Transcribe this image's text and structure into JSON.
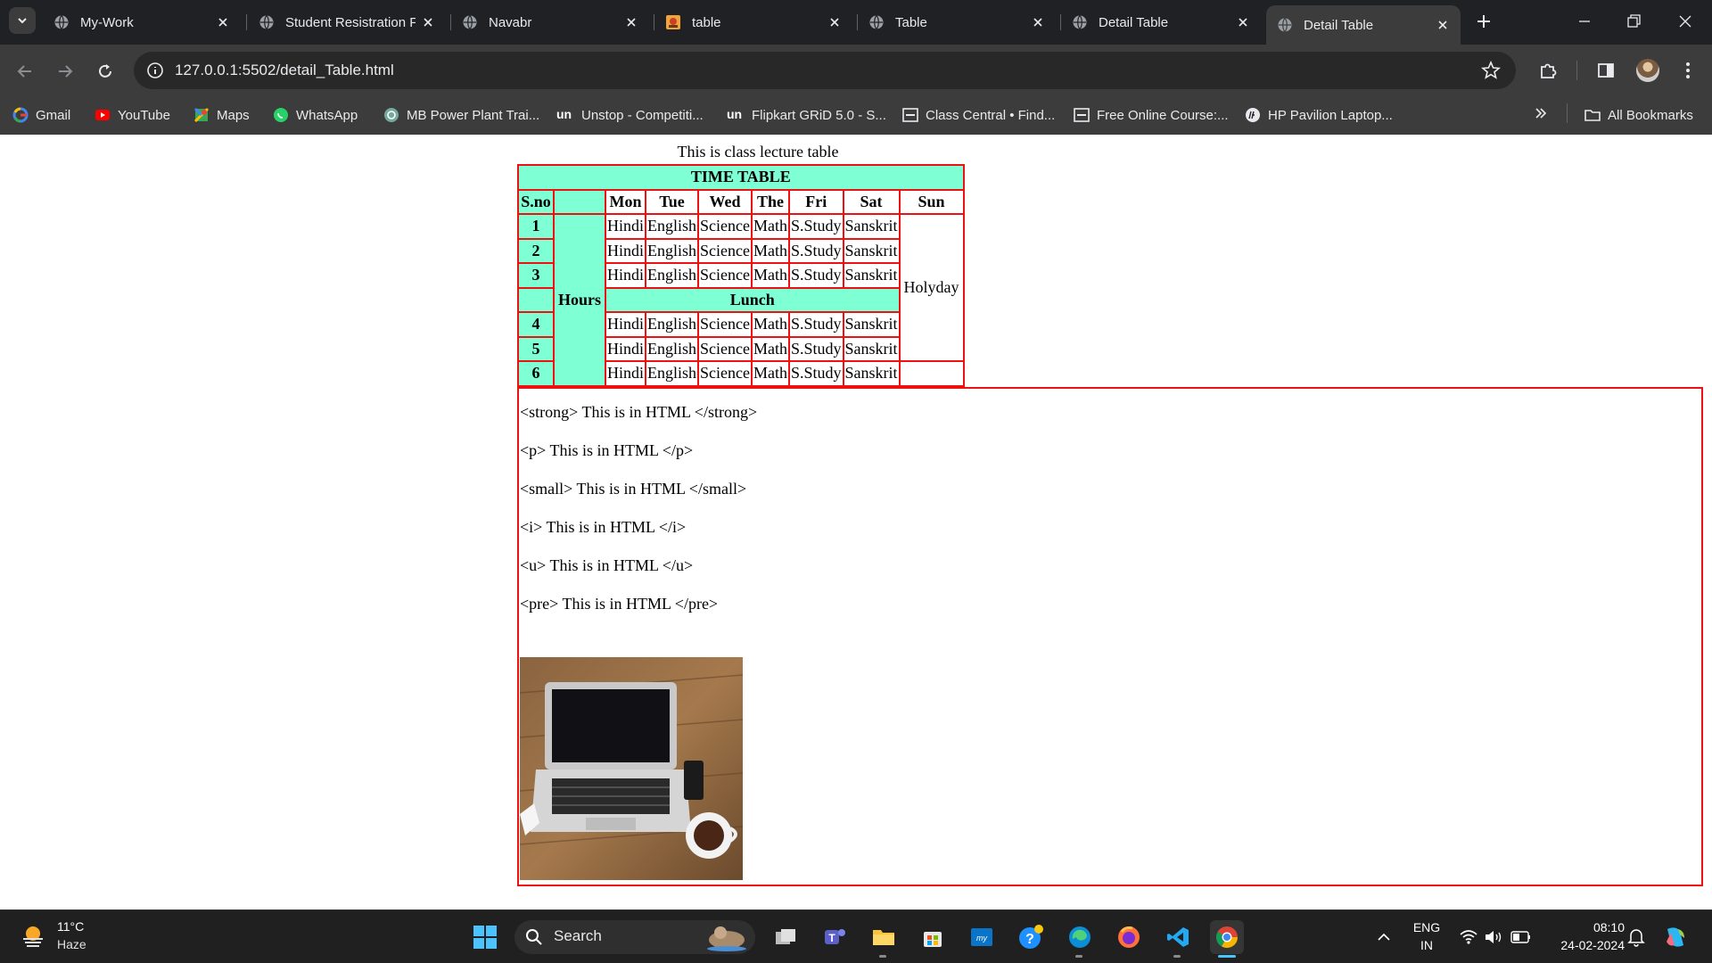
{
  "browser": {
    "tabs": [
      {
        "title": "My-Work",
        "favicon": "globe-icon",
        "active": false
      },
      {
        "title": "Student Resistration F",
        "favicon": "globe-icon",
        "active": false
      },
      {
        "title": "Navabr",
        "favicon": "globe-icon",
        "active": false
      },
      {
        "title": "table",
        "favicon": "photo-favicon-icon",
        "active": false
      },
      {
        "title": "Table",
        "favicon": "globe-icon",
        "active": false
      },
      {
        "title": "Detail Table",
        "favicon": "globe-icon",
        "active": false
      },
      {
        "title": "Detail Table",
        "favicon": "globe-icon",
        "active": true
      }
    ],
    "url": "127.0.0.1:5502/detail_Table.html",
    "bookmarks": [
      {
        "label": "Gmail",
        "icon": "google-icon"
      },
      {
        "label": "YouTube",
        "icon": "youtube-icon"
      },
      {
        "label": "Maps",
        "icon": "maps-icon"
      },
      {
        "label": "WhatsApp",
        "icon": "whatsapp-icon"
      },
      {
        "label": "MB Power Plant Trai...",
        "icon": "chatgpt-icon"
      },
      {
        "label": "Unstop - Competiti...",
        "icon": "unstop-icon"
      },
      {
        "label": "Flipkart GRiD 5.0 - S...",
        "icon": "unstop-icon"
      },
      {
        "label": "Class Central • Find...",
        "icon": "classcentral-icon"
      },
      {
        "label": "Free Online Course:...",
        "icon": "classcentral-icon"
      },
      {
        "label": "HP Pavilion Laptop...",
        "icon": "hp-icon"
      }
    ],
    "all_bookmarks": "All Bookmarks",
    "colors": {
      "tabstrip": "#202124",
      "toolbar": "#3c3c3c",
      "text": "#e8eaed"
    }
  },
  "page": {
    "caption": "This is class lecture table",
    "table": {
      "title": "TIME TABLE",
      "sno_header": "S.no",
      "day_headers": [
        "Mon",
        "Tue",
        "Wed",
        "The",
        "Fri",
        "Sat",
        "Sun"
      ],
      "hours_label": "Hours",
      "lunch_label": "Lunch",
      "holiday_label": "Holyday",
      "rows_before_lunch": [
        {
          "no": "1",
          "cells": [
            "Hindi",
            "English",
            "Science",
            "Math",
            "S.Study",
            "Sanskrit"
          ]
        },
        {
          "no": "2",
          "cells": [
            "Hindi",
            "English",
            "Science",
            "Math",
            "S.Study",
            "Sanskrit"
          ]
        },
        {
          "no": "3",
          "cells": [
            "Hindi",
            "English",
            "Science",
            "Math",
            "S.Study",
            "Sanskrit"
          ]
        }
      ],
      "rows_after_lunch": [
        {
          "no": "4",
          "cells": [
            "Hindi",
            "English",
            "Science",
            "Math",
            "S.Study",
            "Sanskrit"
          ]
        },
        {
          "no": "5",
          "cells": [
            "Hindi",
            "English",
            "Science",
            "Math",
            "S.Study",
            "Sanskrit"
          ]
        },
        {
          "no": "6",
          "cells": [
            "Hindi",
            "English",
            "Science",
            "Math",
            "S.Study",
            "Sanskrit"
          ]
        }
      ],
      "colors": {
        "border": "#ee1111",
        "highlight": "#7fffd4"
      }
    },
    "html_lines": [
      "<strong> This is in HTML </strong>",
      "<p> This is in HTML </p>",
      "<small> This is in HTML </small>",
      "<i> This is in HTML </i>",
      "<u> This is in HTML </u>",
      "<pre> This is in HTML </pre>"
    ]
  },
  "taskbar": {
    "weather": {
      "temp": "11°C",
      "condition": "Haze"
    },
    "search_label": "Search",
    "apps": [
      "start-icon",
      "task-view-icon",
      "teams-icon",
      "file-explorer-icon",
      "store-icon",
      "myhp-icon",
      "help-icon",
      "edge-icon",
      "firefox-icon",
      "vscode-icon",
      "chrome-icon"
    ],
    "tray": {
      "lang": "ENG",
      "region": "IN",
      "time": "08:10",
      "date": "24-02-2024"
    }
  }
}
